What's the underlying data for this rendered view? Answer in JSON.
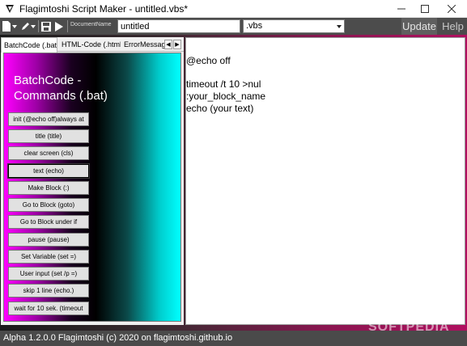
{
  "window": {
    "title": "Flagimtoshi Script Maker - untitled.vbs*"
  },
  "toolbar": {
    "document_name_label": "DocumentName",
    "document_name_value": "untitled",
    "extension_value": ".vbs",
    "update_label": "Update",
    "help_label": "Help"
  },
  "tabs": [
    {
      "label": "BatchCode (.bat)",
      "active": true
    },
    {
      "label": "HTML-Code (.html)",
      "active": false
    },
    {
      "label": "ErrorMessage",
      "active": false
    }
  ],
  "panel": {
    "title_line1": "BatchCode -",
    "title_line2": "Commands (.bat)",
    "buttons": [
      "init (@echo off)always at",
      "title (title)",
      "clear screen (cls)",
      "text (echo)",
      "Make Block (:)",
      "Go to Block (goto)",
      "Go to Block under if",
      "pause (pause)",
      "Set Variable (set =)",
      "User input (set /p =)",
      "skip 1 line (echo.)",
      "wait for 10 sek. (timeout"
    ]
  },
  "editor": {
    "lines": [
      "@echo off",
      "",
      "timeout /t 10 >nul",
      ":your_block_name",
      "echo (your text)"
    ]
  },
  "status": {
    "text": "Alpha 1.2.0.0 Flagimtoshi (c) 2020 on flagimtoshi.github.io"
  },
  "watermark": "SOFTPEDIA",
  "colors": {
    "toolbar_bg": "#4c4c4c",
    "panel_left": "#ff00ff",
    "panel_right": "#00ffff",
    "frame_accent": "#b0105f"
  },
  "icons": {
    "app": "app-icon",
    "new": "new-file-icon",
    "edit": "pen-icon",
    "save": "save-icon",
    "run": "play-icon",
    "minimize": "minimize-icon",
    "maximize": "maximize-icon",
    "close": "close-icon"
  }
}
